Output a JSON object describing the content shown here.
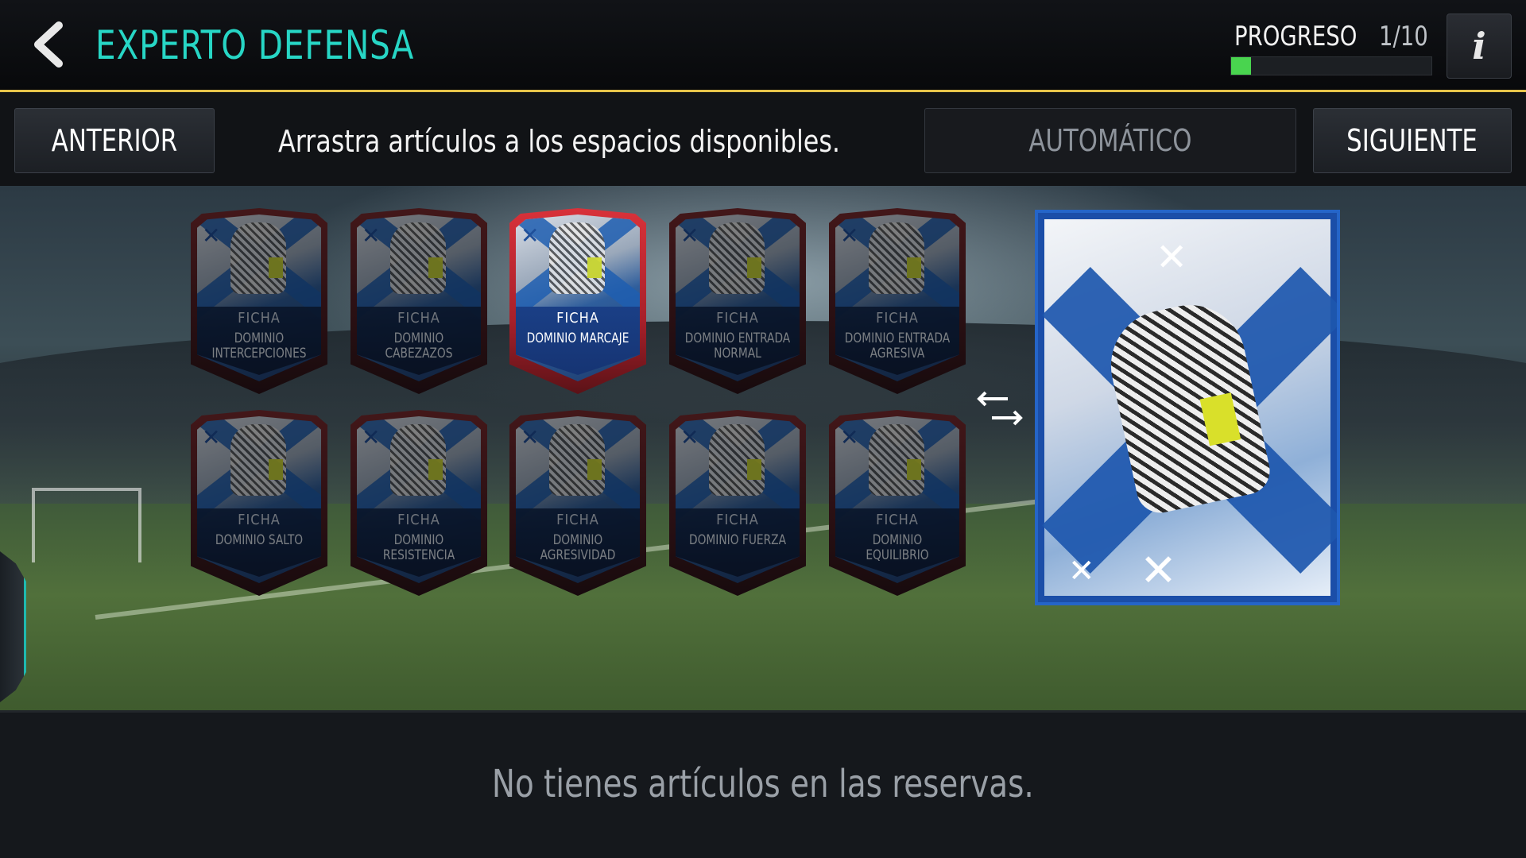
{
  "header": {
    "title": "EXPERTO DEFENSA",
    "progress_label": "PROGRESO",
    "progress_count": "1/10",
    "progress_fraction": 0.1,
    "info_label": "i"
  },
  "toolbar": {
    "prev_label": "ANTERIOR",
    "instructions": "Arrastra artículos a los espacios disponibles.",
    "auto_label": "AUTOMÁTICO",
    "next_label": "SIGUIENTE"
  },
  "cards": [
    {
      "type": "FICHA",
      "name": "DOMINIO INTERCEPCIONES",
      "state": "dim"
    },
    {
      "type": "FICHA",
      "name": "DOMINIO CABEZAZOS",
      "state": "dim"
    },
    {
      "type": "FICHA",
      "name": "DOMINIO MARCAJE",
      "state": "active"
    },
    {
      "type": "FICHA",
      "name": "DOMINIO ENTRADA NORMAL",
      "state": "dim"
    },
    {
      "type": "FICHA",
      "name": "DOMINIO ENTRADA AGRESIVA",
      "state": "dim"
    },
    {
      "type": "FICHA",
      "name": "DOMINIO SALTO",
      "state": "dim"
    },
    {
      "type": "FICHA",
      "name": "DOMINIO RESISTENCIA",
      "state": "dim"
    },
    {
      "type": "FICHA",
      "name": "DOMINIO AGRESIVIDAD",
      "state": "dim"
    },
    {
      "type": "FICHA",
      "name": "DOMINIO FUERZA",
      "state": "dim"
    },
    {
      "type": "FICHA",
      "name": "DOMINIO EQUILIBRIO",
      "state": "dim"
    }
  ],
  "reserve": {
    "message": "No tienes artículos en las reservas."
  },
  "colors": {
    "accent": "#27d6c5",
    "progress": "#49d44f",
    "header_line": "#e6c44a",
    "card_blue": "#1d57ae"
  }
}
